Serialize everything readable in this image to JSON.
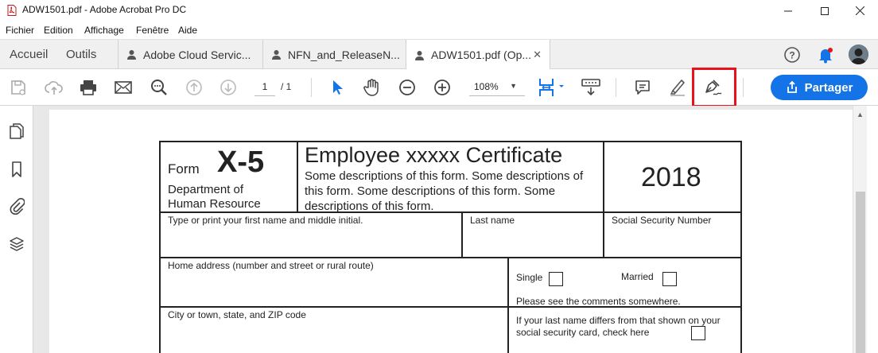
{
  "window": {
    "title": "ADW1501.pdf - Adobe Acrobat Pro DC"
  },
  "menu": [
    "Fichier",
    "Edition",
    "Affichage",
    "Fenêtre",
    "Aide"
  ],
  "nav": {
    "home": "Accueil",
    "tools": "Outils"
  },
  "tabs": [
    {
      "label": "Adobe Cloud Servic...",
      "icon": "shared-doc-icon"
    },
    {
      "label": "NFN_and_ReleaseN...",
      "icon": "shared-doc-icon"
    },
    {
      "label": "ADW1501.pdf (Op...",
      "icon": "shared-doc-icon",
      "active": true
    }
  ],
  "toolbar": {
    "page_current": "1",
    "page_total": "/ 1",
    "zoom": "108%",
    "share_label": "Partager"
  },
  "colors": {
    "accent": "#1473e6",
    "highlight": "#e8131a",
    "cursor_tool": "#1473e6"
  },
  "form": {
    "form_word": "Form",
    "form_number": "X-5",
    "department": "Department of Human Resource",
    "title": "Employee xxxxx Certificate",
    "description": "Some descriptions of this form. Some descriptions of this form. Some descriptions of this form. Some descriptions of this form.",
    "year": "2018",
    "first_name_label": "Type or print your first name and middle initial.",
    "last_name_label": "Last name",
    "ssn_label": "Social Security Number",
    "address_label": "Home address (number and street or rural route)",
    "single_label": "Single",
    "married_label": "Married",
    "comments_note": "Please see the comments somewhere.",
    "city_label": "City or town, state, and ZIP code",
    "last_name_differs_note": "If your last name differs from that shown on your social security card, check here"
  }
}
